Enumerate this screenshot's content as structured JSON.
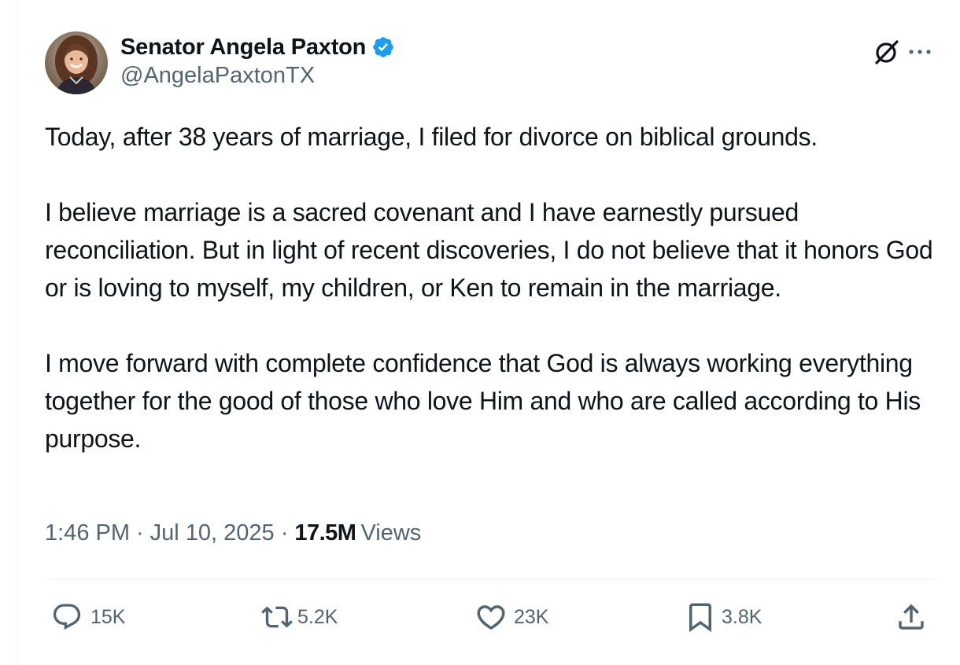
{
  "author": {
    "display_name": "Senator Angela Paxton",
    "handle": "@AngelaPaxtonTX",
    "verified": true,
    "verified_color": "#1d9bf0"
  },
  "tweet": {
    "paragraphs": [
      "Today, after 38 years of marriage, I filed for divorce on biblical grounds.",
      "I believe marriage is a sacred covenant and I have earnestly pursued reconciliation. But in light of recent discoveries, I do not believe that it honors God or is loving to myself, my children, or Ken to remain in the marriage.",
      "I move forward with complete confidence that God is always working everything together for the good of those who love Him and who are called according to His purpose."
    ],
    "time": "1:46 PM",
    "separator": "·",
    "date": "Jul 10, 2025",
    "views_count": "17.5M",
    "views_label": "Views"
  },
  "actions": {
    "replies": "15K",
    "reposts": "5.2K",
    "likes": "23K",
    "bookmarks": "3.8K"
  },
  "icons": {
    "top": [
      "grok-icon",
      "more-icon"
    ],
    "bar": [
      "reply-icon",
      "repost-icon",
      "like-icon",
      "bookmark-icon",
      "share-icon"
    ]
  },
  "colors": {
    "text": "#0f1419",
    "secondary": "#536471",
    "divider": "#eff3f4"
  }
}
